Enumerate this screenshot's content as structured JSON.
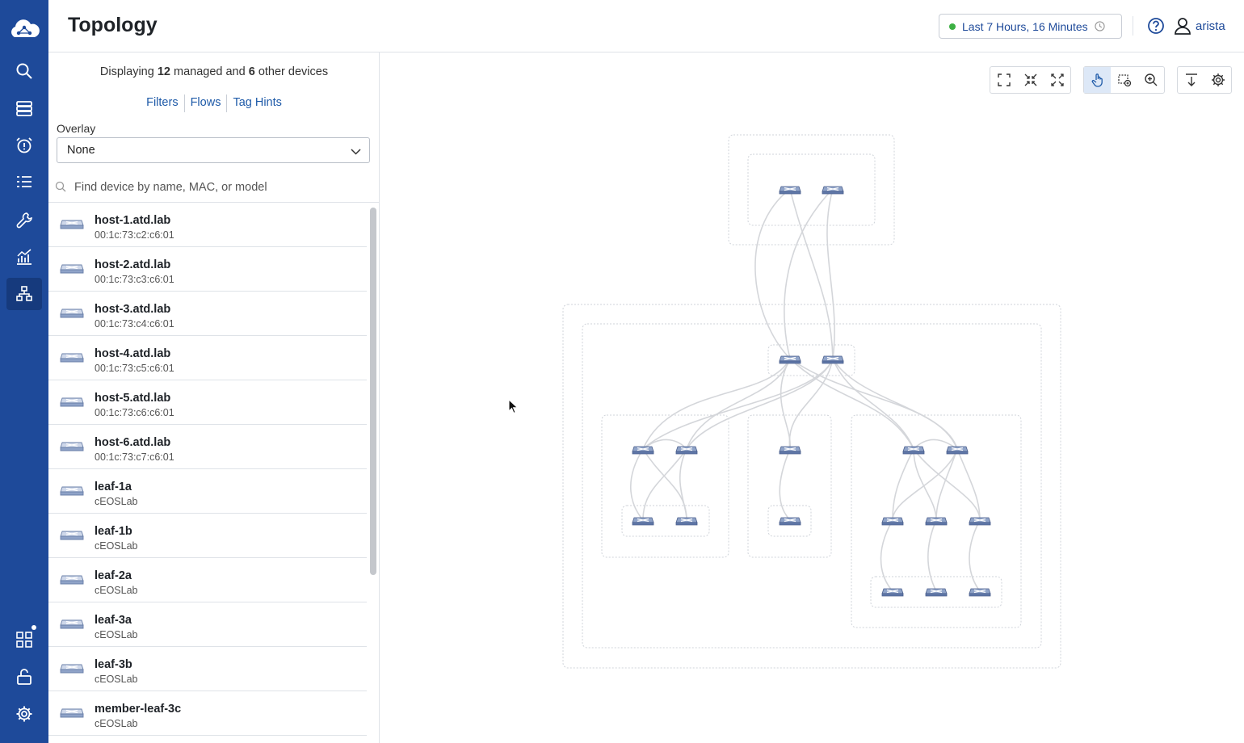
{
  "header": {
    "title": "Topology",
    "time_range": "Last 7 Hours, 16 Minutes",
    "user": "arista"
  },
  "nav": {
    "items": [
      "logo-icon",
      "search-icon",
      "devices-icon",
      "events-icon",
      "workspace-icon",
      "provisioning-icon",
      "dashboards-icon",
      "topology-icon",
      "apps-icon",
      "unlock-icon",
      "settings-icon"
    ],
    "active": "topology-icon"
  },
  "panel": {
    "summary_prefix": "Displaying ",
    "managed_count": "12",
    "summary_mid": " managed and ",
    "other_count": "6",
    "summary_suffix": " other devices",
    "links": [
      "Filters",
      "Flows",
      "Tag Hints"
    ],
    "overlay_label": "Overlay",
    "overlay_value": "None",
    "search_placeholder": "Find device by name, MAC, or model"
  },
  "devices": [
    {
      "name": "host-1.atd.lab",
      "sub": "00:1c:73:c2:c6:01"
    },
    {
      "name": "host-2.atd.lab",
      "sub": "00:1c:73:c3:c6:01"
    },
    {
      "name": "host-3.atd.lab",
      "sub": "00:1c:73:c4:c6:01"
    },
    {
      "name": "host-4.atd.lab",
      "sub": "00:1c:73:c5:c6:01"
    },
    {
      "name": "host-5.atd.lab",
      "sub": "00:1c:73:c6:c6:01"
    },
    {
      "name": "host-6.atd.lab",
      "sub": "00:1c:73:c7:c6:01"
    },
    {
      "name": "leaf-1a",
      "sub": "cEOSLab"
    },
    {
      "name": "leaf-1b",
      "sub": "cEOSLab"
    },
    {
      "name": "leaf-2a",
      "sub": "cEOSLab"
    },
    {
      "name": "leaf-3a",
      "sub": "cEOSLab"
    },
    {
      "name": "leaf-3b",
      "sub": "cEOSLab"
    },
    {
      "name": "member-leaf-3c",
      "sub": "cEOSLab"
    }
  ],
  "toolbar": {
    "layout": [
      "fit-screen-icon",
      "collapse-all-icon",
      "expand-all-icon"
    ],
    "mode": [
      "pan-mode-icon",
      "select-mode-icon",
      "zoom-icon"
    ],
    "misc": [
      "export-icon",
      "settings-icon"
    ],
    "active_mode": "pan-mode-icon"
  },
  "colors": {
    "nav_bg": "#1e4a9a",
    "accent": "#1e5aa8",
    "live": "#3cb043",
    "device_fill": "#8fa3c8"
  }
}
